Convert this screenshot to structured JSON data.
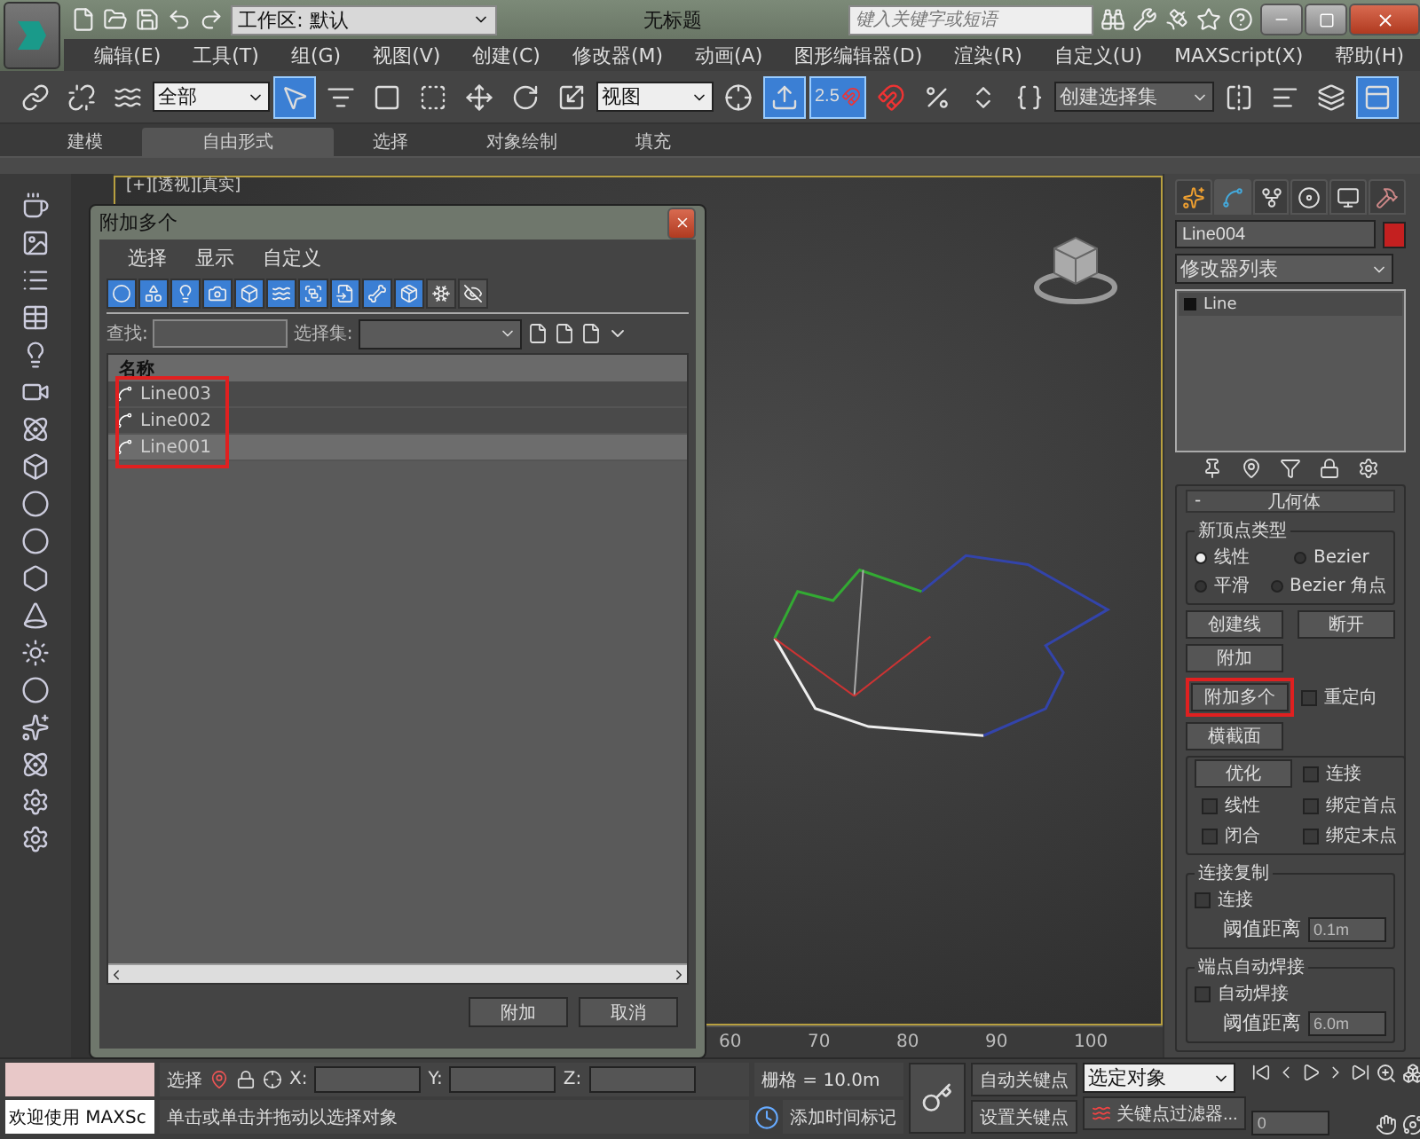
{
  "app": {
    "title": "无标题",
    "workspace": "工作区: 默认",
    "search": {
      "placeholder": "键入关键字或短语"
    }
  },
  "menu": [
    "编辑(E)",
    "工具(T)",
    "组(G)",
    "视图(V)",
    "创建(C)",
    "修改器(M)",
    "动画(A)",
    "图形编辑器(D)",
    "渲染(R)",
    "自定义(U)",
    "MAXScript(X)",
    "帮助(H)"
  ],
  "toolbar": {
    "tools": [
      {
        "kind": "link",
        "selected": false
      },
      {
        "kind": "unlink",
        "selected": false
      },
      {
        "kind": "bind",
        "selected": false
      },
      {
        "kind": "dropdown",
        "value": "全部"
      },
      {
        "kind": "select",
        "selected": true
      },
      {
        "kind": "select_name",
        "selected": false
      },
      {
        "kind": "region",
        "selected": false
      },
      {
        "kind": "window",
        "selected": false
      },
      {
        "kind": "move",
        "selected": false
      },
      {
        "kind": "rotate",
        "selected": false
      },
      {
        "kind": "scale",
        "selected": false
      },
      {
        "kind": "dropdown",
        "value": "视图"
      },
      {
        "kind": "pivot",
        "selected": false
      },
      {
        "kind": "manipulate",
        "selected": true
      },
      {
        "kind": "snap",
        "label": "2.5",
        "selected": true
      },
      {
        "kind": "angle",
        "selected": false
      },
      {
        "kind": "percent",
        "selected": false
      },
      {
        "kind": "spinner",
        "selected": false
      },
      {
        "kind": "sets",
        "selected": false
      },
      {
        "kind": "dropdown",
        "value": "创建选择集"
      },
      {
        "kind": "mirror",
        "selected": false
      },
      {
        "kind": "align",
        "selected": false
      },
      {
        "kind": "layers",
        "selected": false
      },
      {
        "kind": "ribbon",
        "selected": true
      }
    ]
  },
  "ribbon": {
    "tabs": [
      {
        "label": "建模",
        "selected": false
      },
      {
        "label": "自由形式",
        "selected": true
      },
      {
        "label": "选择",
        "selected": false
      },
      {
        "label": "对象绘制",
        "selected": false
      },
      {
        "label": "填充",
        "selected": false
      }
    ]
  },
  "viewport": {
    "label": "[+][透视][真实]",
    "timeline_ticks": [
      "60",
      "70",
      "80",
      "90",
      "100"
    ]
  },
  "dialog": {
    "title": "附加多个",
    "menu": [
      "选择",
      "显示",
      "自定义"
    ],
    "filters": [
      {
        "kind": "geometry",
        "on": true
      },
      {
        "kind": "shape",
        "on": true
      },
      {
        "kind": "light",
        "on": true
      },
      {
        "kind": "camera",
        "on": true
      },
      {
        "kind": "helper",
        "on": true
      },
      {
        "kind": "warp",
        "on": true
      },
      {
        "kind": "group",
        "on": true
      },
      {
        "kind": "xref",
        "on": true
      },
      {
        "kind": "bone",
        "on": true
      },
      {
        "kind": "container",
        "on": true
      },
      {
        "kind": "frozen",
        "on": false
      },
      {
        "kind": "hidden",
        "on": false
      }
    ],
    "find_label": "查找:",
    "set_label": "选择集:",
    "column": "名称",
    "rows": [
      {
        "name": "Line003",
        "selected": false
      },
      {
        "name": "Line002",
        "selected": false
      },
      {
        "name": "Line001",
        "selected": true
      }
    ],
    "rows_highlighted": true,
    "buttons": [
      "附加",
      "取消"
    ]
  },
  "panel": {
    "tabs": [
      {
        "kind": "create",
        "selected": false
      },
      {
        "kind": "modify",
        "selected": true
      },
      {
        "kind": "hierarchy",
        "selected": false
      },
      {
        "kind": "motion",
        "selected": false
      },
      {
        "kind": "display",
        "selected": false
      },
      {
        "kind": "utilities",
        "selected": false
      }
    ],
    "object_name": "Line004",
    "modifier_list": "修改器列表",
    "stack": [
      "Line"
    ],
    "rollout": {
      "toggle": "-",
      "title": "几何体"
    },
    "vertex_type": {
      "title": "新顶点类型",
      "options": [
        {
          "label": "线性",
          "selected": true
        },
        {
          "label": "Bezier",
          "selected": false
        },
        {
          "label": "平滑",
          "selected": false
        },
        {
          "label": "Bezier 角点",
          "selected": false
        }
      ]
    },
    "create_line": "创建线",
    "break": "断开",
    "attach": "附加",
    "attach_multiple": {
      "label": "附加多个",
      "highlighted": true
    },
    "reorient": {
      "label": "重定向",
      "checked": false
    },
    "cross_section": "横截面",
    "refine": {
      "button": "优化",
      "checks": [
        {
          "label": "连接",
          "checked": false
        },
        {
          "label": "线性",
          "checked": false
        },
        {
          "label": "绑定首点",
          "checked": false
        },
        {
          "label": "闭合",
          "checked": false
        },
        {
          "label": "绑定末点",
          "checked": false
        }
      ]
    },
    "connect_copy": {
      "title": "连接复制",
      "check": {
        "label": "连接",
        "checked": false
      },
      "threshold_label": "阈值距离",
      "threshold": "0.1m"
    },
    "end_weld": {
      "title": "端点自动焊接",
      "check": {
        "label": "自动焊接",
        "checked": false
      },
      "threshold_label": "阈值距离",
      "threshold": "6.0m"
    }
  },
  "status": {
    "welcome": "欢迎使用 MAXSc",
    "select_label": "选择",
    "x": "X:",
    "y": "Y:",
    "z": "Z:",
    "grid": "栅格 = 10.0m",
    "prompt": "单击或单击并拖动以选择对象",
    "add_tag": "添加时间标记",
    "auto_key": "自动关键点",
    "set_key": "设置关键点",
    "key_mode": "选定对象",
    "key_filters": "关键点过滤器...",
    "frame": "0"
  }
}
